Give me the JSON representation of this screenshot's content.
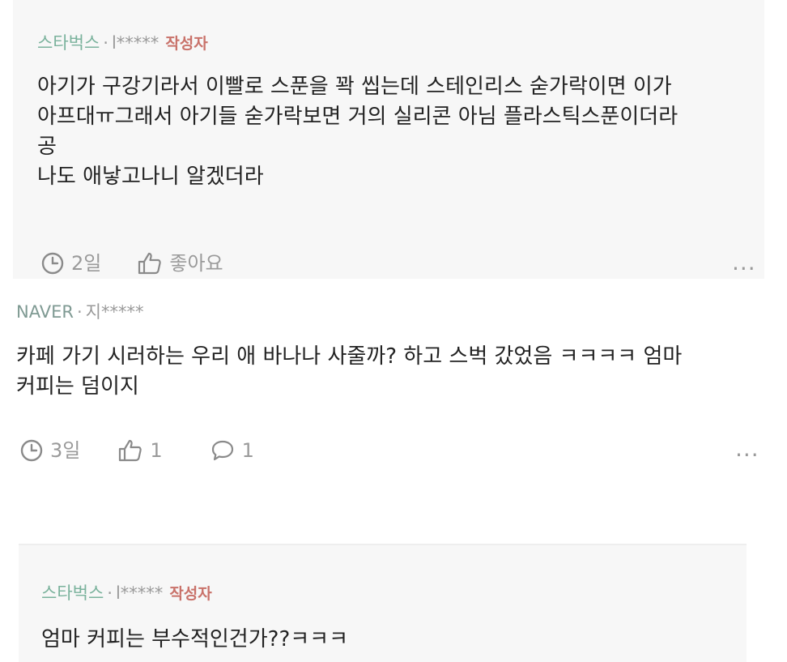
{
  "comments": [
    {
      "author": "스타벅스",
      "separator": "·",
      "masked_user": "l*****",
      "badge": "작성자",
      "lines": [
        "아기가 구강기라서 이빨로 스푼을 꽉 씹는데 스테인리스 숟가락이면 이가",
        "아프대ㅠ그래서 아기들 숟가락보면 거의 실리콘 아님 플라스틱스푼이더라",
        "공",
        "나도 애낳고나니 알겠더라"
      ],
      "time": "2일",
      "like_label": "좋아요",
      "more": "···"
    },
    {
      "author": "NAVER",
      "separator": "·",
      "masked_user": "지*****",
      "lines": [
        "카페 가기 시러하는 우리 애 바나나 사줄까? 하고 스벅 갔었음 ㅋㅋㅋㅋ 엄마",
        "커피는 덤이지"
      ],
      "time": "3일",
      "like_count": "1",
      "reply_count": "1",
      "more": "···"
    },
    {
      "author": "스타벅스",
      "separator": "·",
      "masked_user": "l*****",
      "badge": "작성자",
      "lines": [
        "엄마 커피는 부수적인건가??ㅋㅋㅋ"
      ]
    }
  ],
  "colors": {
    "author_green": "#7ab29c",
    "badge_red": "#c9726a",
    "panel_bg": "#f7f7f7",
    "meta_grey": "#9a9a9a"
  },
  "icons": {
    "time": "clock-icon",
    "like": "thumbs-up-icon",
    "reply": "speech-bubble-icon",
    "more": "more-dots-icon"
  }
}
